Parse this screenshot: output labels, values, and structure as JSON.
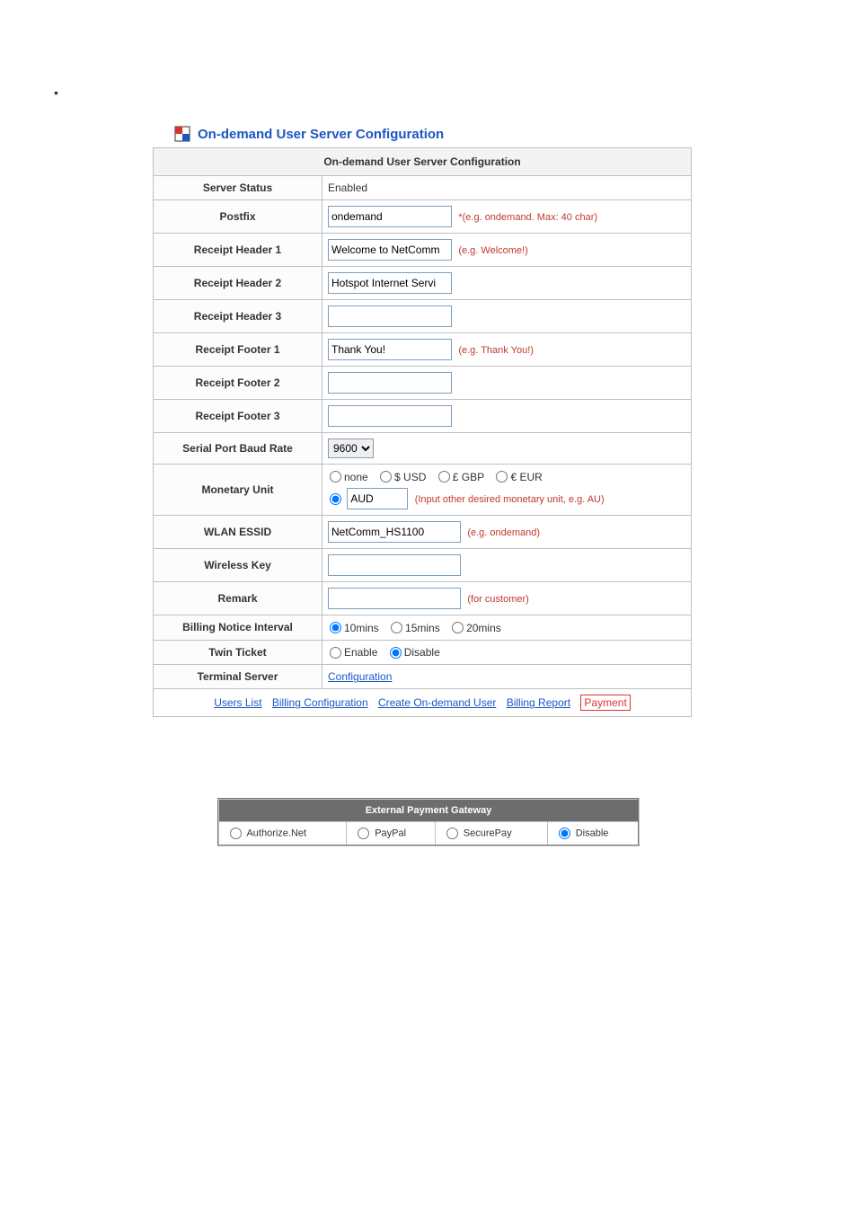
{
  "pageTitle": "On-demand User Server Configuration",
  "tableTitle": "On-demand User Server Configuration",
  "rows": {
    "serverStatus": {
      "label": "Server Status",
      "value": "Enabled"
    },
    "postfix": {
      "label": "Postfix",
      "value": "ondemand",
      "hint": "*(e.g. ondemand. Max: 40 char)"
    },
    "rh1": {
      "label": "Receipt Header 1",
      "value": "Welcome to NetComm",
      "hint": "(e.g. Welcome!)"
    },
    "rh2": {
      "label": "Receipt Header 2",
      "value": "Hotspot Internet Servi"
    },
    "rh3": {
      "label": "Receipt Header 3",
      "value": ""
    },
    "rf1": {
      "label": "Receipt Footer 1",
      "value": "Thank You!",
      "hint": "(e.g. Thank You!)"
    },
    "rf2": {
      "label": "Receipt Footer 2",
      "value": ""
    },
    "rf3": {
      "label": "Receipt Footer 3",
      "value": ""
    },
    "baud": {
      "label": "Serial Port Baud Rate",
      "value": "9600"
    },
    "monetary": {
      "label": "Monetary Unit",
      "options": {
        "none": "none",
        "usd": "$ USD",
        "gbp": "£ GBP",
        "eur": "€ EUR"
      },
      "customValue": "AUD",
      "hint": "(Input other desired monetary unit, e.g. AU)"
    },
    "essid": {
      "label": "WLAN ESSID",
      "value": "NetComm_HS1100",
      "hint": "(e.g. ondemand)"
    },
    "wkey": {
      "label": "Wireless Key",
      "value": ""
    },
    "remark": {
      "label": "Remark",
      "value": "",
      "hint": "(for customer)"
    },
    "billingInterval": {
      "label": "Billing Notice Interval",
      "options": [
        "10mins",
        "15mins",
        "20mins"
      ],
      "selected": "10mins"
    },
    "twinTicket": {
      "label": "Twin Ticket",
      "options": [
        "Enable",
        "Disable"
      ],
      "selected": "Disable"
    },
    "terminal": {
      "label": "Terminal Server",
      "linkText": "Configuration"
    }
  },
  "bottomLinks": {
    "usersList": "Users List",
    "billingConfig": "Billing Configuration",
    "createUser": "Create On-demand User",
    "billingReport": "Billing Report",
    "payment": "Payment"
  },
  "epg": {
    "title": "External Payment Gateway",
    "options": [
      "Authorize.Net",
      "PayPal",
      "SecurePay",
      "Disable"
    ],
    "selected": "Disable"
  }
}
